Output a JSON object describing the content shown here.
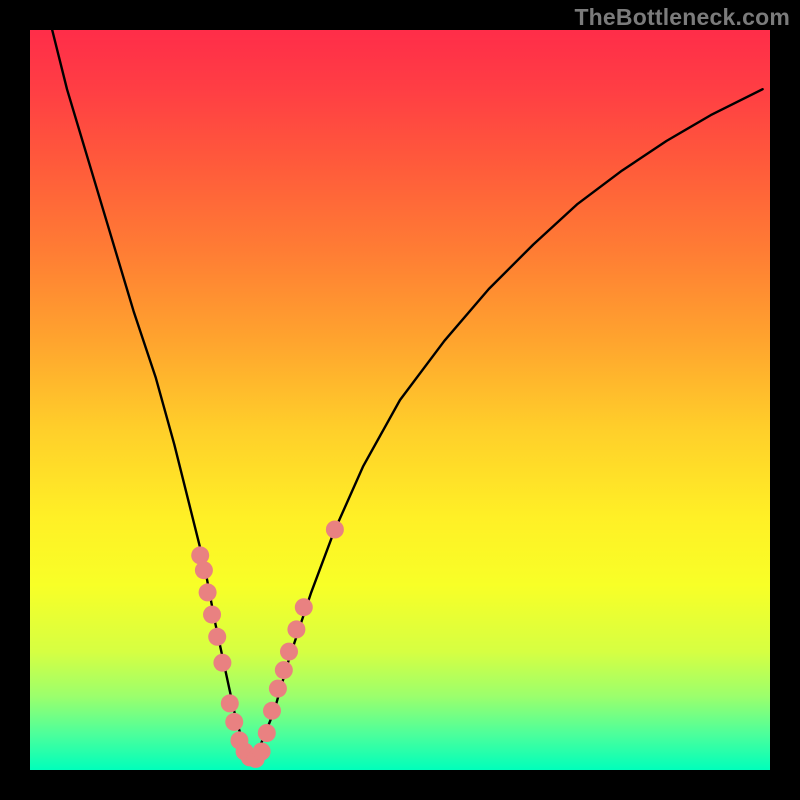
{
  "watermark": "TheBottleneck.com",
  "chart_data": {
    "type": "line",
    "title": "",
    "xlabel": "",
    "ylabel": "",
    "xlim": [
      0,
      100
    ],
    "ylim": [
      0,
      100
    ],
    "series": [
      {
        "name": "curve",
        "x": [
          3,
          5,
          8,
          11,
          14,
          17,
          19.5,
          21.5,
          23.5,
          25,
          26.5,
          27.8,
          29,
          30,
          31,
          33,
          35,
          38,
          41,
          45,
          50,
          56,
          62,
          68,
          74,
          80,
          86,
          92,
          99
        ],
        "values": [
          100,
          92,
          82,
          72,
          62,
          53,
          44,
          36,
          28,
          20,
          13,
          7,
          3,
          1.5,
          3,
          8,
          15,
          24,
          32,
          41,
          50,
          58,
          65,
          71,
          76.5,
          81,
          85,
          88.5,
          92
        ]
      }
    ],
    "markers": {
      "name": "data-points",
      "color": "#e98181",
      "x": [
        23,
        23.5,
        24,
        24.6,
        25.3,
        26,
        27,
        27.6,
        28.3,
        29,
        29.7,
        30.5,
        31.3,
        32,
        32.7,
        33.5,
        34.3,
        35,
        36,
        37,
        41.2
      ],
      "values": [
        29,
        27,
        24,
        21,
        18,
        14.5,
        9,
        6.5,
        4,
        2.5,
        1.7,
        1.5,
        2.5,
        5,
        8,
        11,
        13.5,
        16,
        19,
        22,
        32.5
      ]
    },
    "green_band": {
      "start_y": 0,
      "end_y": 7
    }
  }
}
